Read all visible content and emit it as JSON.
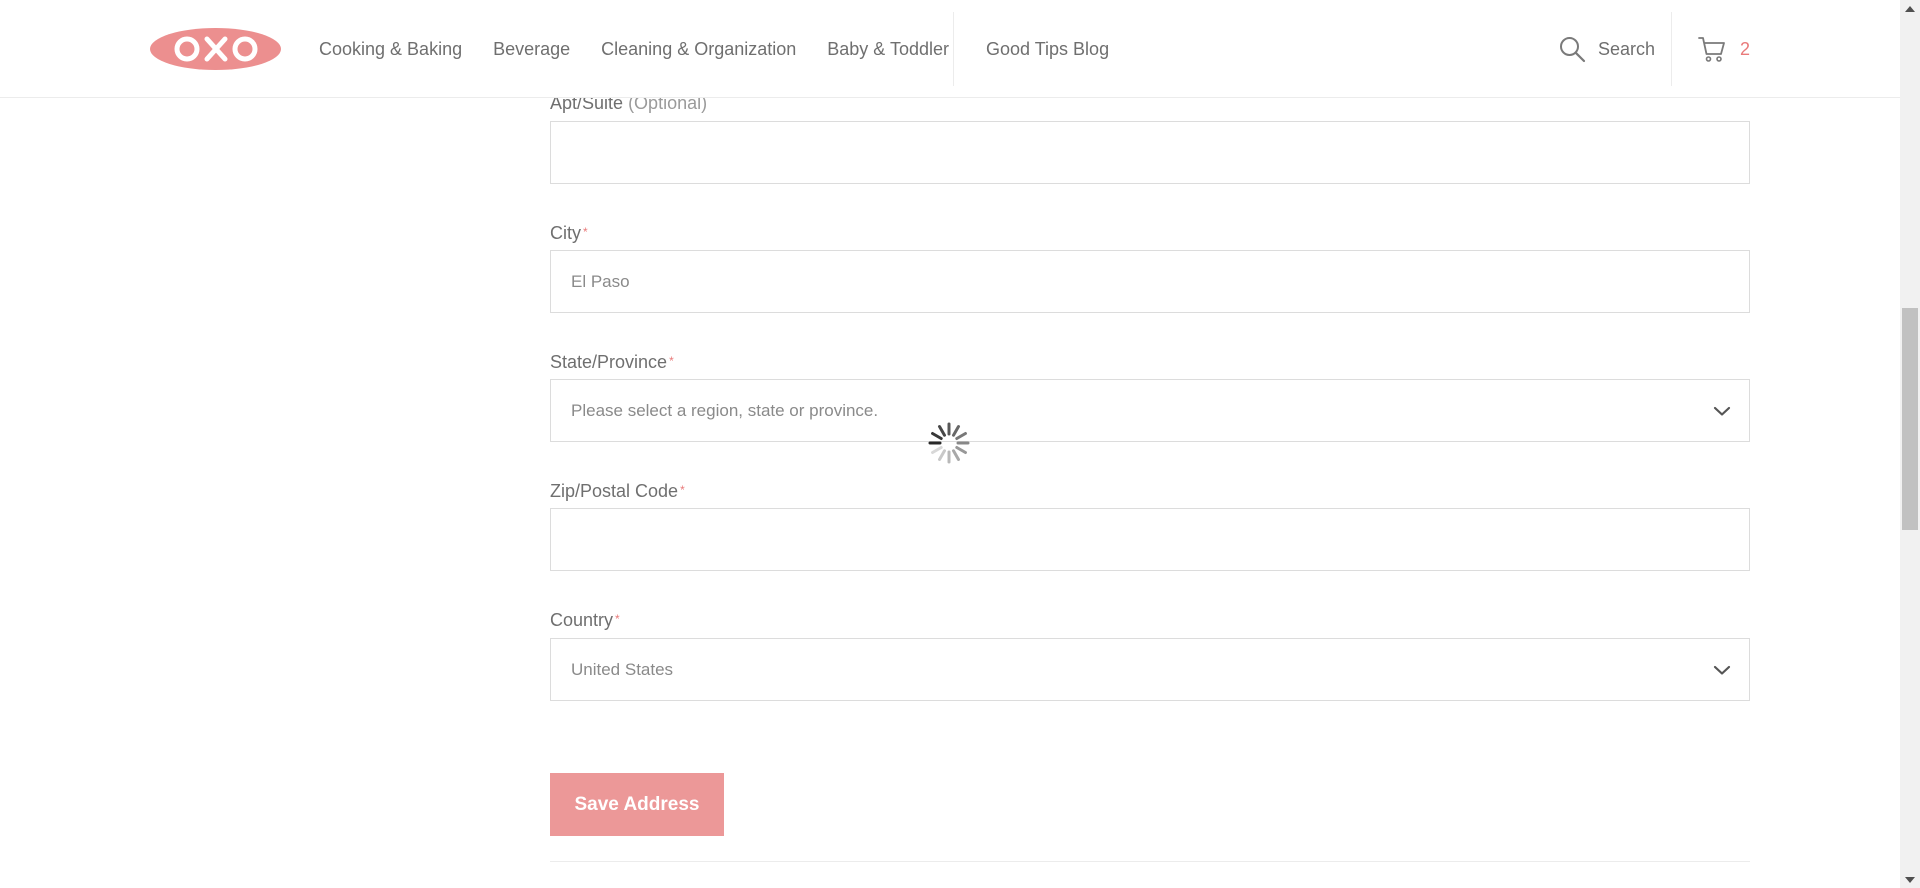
{
  "brand": {
    "logo_text": "OXO",
    "accent_color": "#e97a7a",
    "logo_color": "#ec8f8f"
  },
  "header": {
    "nav": [
      {
        "label": "Cooking & Baking"
      },
      {
        "label": "Beverage"
      },
      {
        "label": "Cleaning & Organization"
      },
      {
        "label": "Baby & Toddler"
      }
    ],
    "blog_label": "Good Tips Blog",
    "search_label": "Search",
    "search_icon": "search-icon",
    "cart_icon": "cart-icon",
    "cart_count": "2"
  },
  "form": {
    "apt": {
      "label": "Apt/Suite",
      "optional": "(Optional)",
      "value": ""
    },
    "city": {
      "label": "City",
      "required_mark": "*",
      "value": "El Paso"
    },
    "state": {
      "label": "State/Province",
      "required_mark": "*",
      "value": "Please select a region, state or province.",
      "icon": "chevron-down-icon"
    },
    "zip": {
      "label": "Zip/Postal Code",
      "required_mark": "*",
      "value": ""
    },
    "country": {
      "label": "Country",
      "required_mark": "*",
      "value": "United States",
      "icon": "chevron-down-icon"
    },
    "save_label": "Save Address",
    "save_color": "#ec9898"
  },
  "loading": {
    "icon": "loading-spinner-icon"
  },
  "scrollbar": {
    "position_fraction": 0.46
  }
}
